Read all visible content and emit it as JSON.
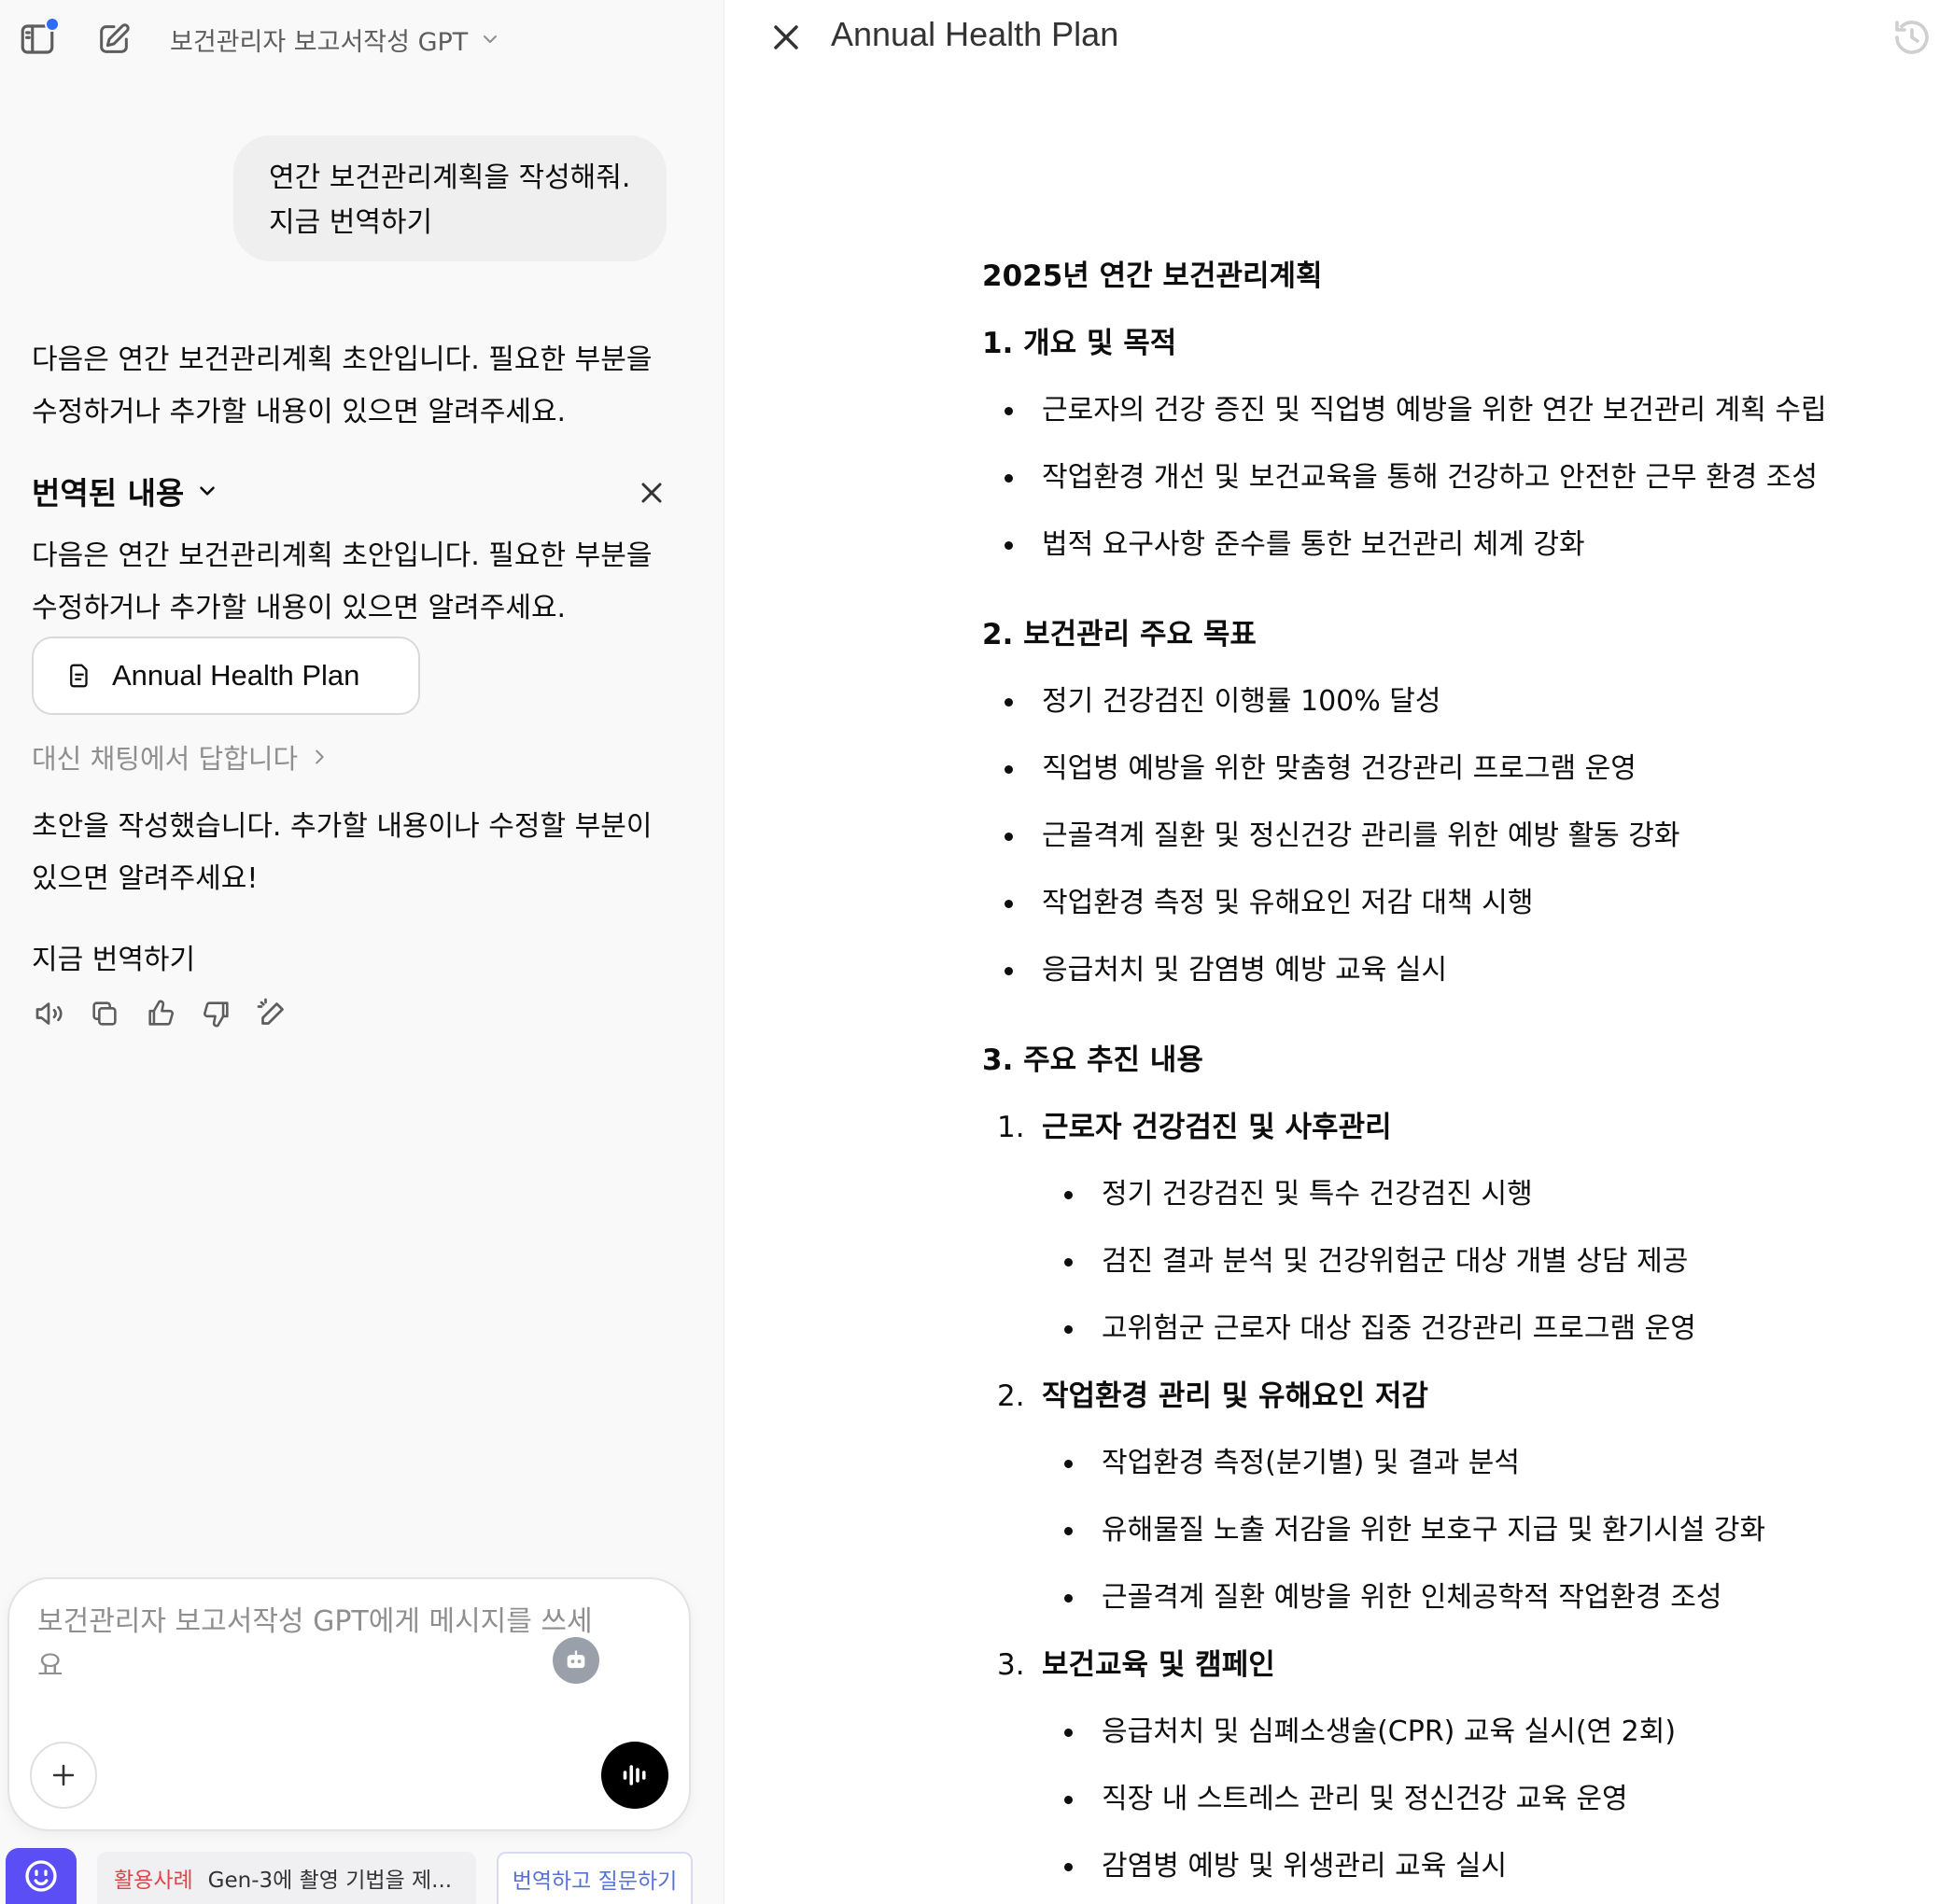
{
  "left": {
    "gpt_title": "보건관리자 보고서작성 GPT",
    "user_message": {
      "line1": "연간 보건관리계획을 작성해줘.",
      "line2": "지금 번역하기"
    },
    "reply_1": "다음은 연간 보건관리계획 초안입니다. 필요한 부분을 수정하거나 추가할 내용이 있으면 알려주세요.",
    "translated_heading": "번역된 내용",
    "reply_2": "다음은 연간 보건관리계획 초안입니다. 필요한 부분을 수정하거나 추가할 내용이 있으면 알려주세요.",
    "doc_card_label": "Annual Health Plan",
    "reply_chat_link": "대신 채팅에서 답합니다",
    "reply_3": "초안을 작성했습니다. 추가할 내용이나 수정할 부분이 있으면 알려주세요!",
    "translate_now": "지금 번역하기",
    "composer_placeholder": "보건관리자 보고서작성 GPT에게 메시지를 쓰세요",
    "bottom": {
      "usecase_tag": "활용사례",
      "usecase_text": "Gen-3에 촬영 기법을 제...",
      "translate_ask": "번역하고 질문하기"
    }
  },
  "canvas": {
    "title": "Annual Health Plan",
    "doc_title": "2025년 연간 보건관리계획",
    "sections": [
      {
        "heading": "1. 개요 및 목적",
        "bullets": [
          "근로자의 건강 증진 및 직업병 예방을 위한 연간 보건관리 계획 수립",
          "작업환경 개선 및 보건교육을 통해 건강하고 안전한 근무 환경 조성",
          "법적 요구사항 준수를 통한 보건관리 체계 강화"
        ]
      },
      {
        "heading": "2. 보건관리 주요 목표",
        "bullets": [
          "정기 건강검진 이행률 100% 달성",
          "직업병 예방을 위한 맞춤형 건강관리 프로그램 운영",
          "근골격계 질환 및 정신건강 관리를 위한 예방 활동 강화",
          "작업환경 측정 및 유해요인 저감 대책 시행",
          "응급처치 및 감염병 예방 교육 실시"
        ]
      },
      {
        "heading": "3. 주요 추진 내용",
        "subsections": [
          {
            "num": "1.",
            "title": "근로자 건강검진 및 사후관리",
            "bullets": [
              "정기 건강검진 및 특수 건강검진 시행",
              "검진 결과 분석 및 건강위험군 대상 개별 상담 제공",
              "고위험군 근로자 대상 집중 건강관리 프로그램 운영"
            ]
          },
          {
            "num": "2.",
            "title": "작업환경 관리 및 유해요인 저감",
            "bullets": [
              "작업환경 측정(분기별) 및 결과 분석",
              "유해물질 노출 저감을 위한 보호구 지급 및 환기시설 강화",
              "근골격계 질환 예방을 위한 인체공학적 작업환경 조성"
            ]
          },
          {
            "num": "3.",
            "title": "보건교육 및 캠페인",
            "bullets": [
              "응급처치 및 심폐소생술(CPR) 교육 실시(연 2회)",
              "직장 내 스트레스 관리 및 정신건강 교육 운영",
              "감염병 예방 및 위생관리 교육 실시"
            ]
          }
        ]
      }
    ]
  },
  "colors": {
    "accent_blue": "#2f6cf6",
    "brand_purple": "#5b4ef5",
    "usecase_red": "#e0454a",
    "link_blue": "#5671d8"
  }
}
